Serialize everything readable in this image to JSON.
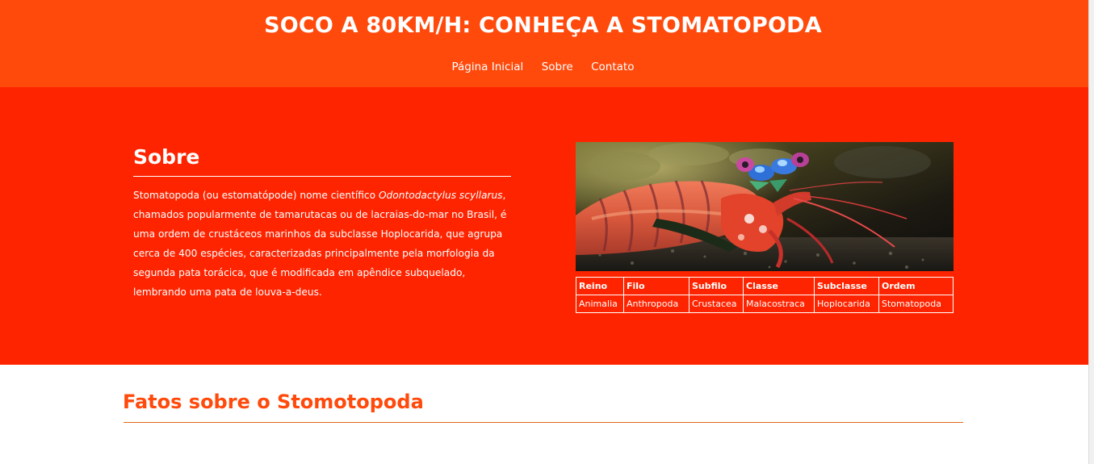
{
  "header": {
    "title": "SOCO A 80KM/H: CONHEÇA A STOMATOPODA",
    "nav": [
      {
        "label": "Página Inicial"
      },
      {
        "label": "Sobre"
      },
      {
        "label": "Contato"
      }
    ]
  },
  "about": {
    "heading": "Sobre",
    "text_before": "Stomatopoda (ou estomatópode) nome científico ",
    "scientific_name": "Odontodactylus scyllarus",
    "text_after": ", chamados popularmente de tamarutacas ou de lacraias-do-mar no Brasil, é uma ordem de crustáceos marinhos da subclasse Hoplocarida, que agrupa cerca de 400 espécies, caracterizadas principalmente pela morfologia da segunda pata torácica, que é modificada em apêndice subquelado, lembrando uma pata de louva-a-deus.",
    "image_subject": "mantis-shrimp-photo",
    "table": {
      "headers": [
        "Reino",
        "Filo",
        "Subfilo",
        "Classe",
        "Subclasse",
        "Ordem"
      ],
      "row": [
        "Animalia",
        "Anthropoda",
        "Crustacea",
        "Malacostraca",
        "Hoplocarida",
        "Stomatopoda"
      ]
    }
  },
  "facts": {
    "heading": "Fatos sobre o Stomotopoda"
  },
  "colors": {
    "header_bg": "#ff4a0c",
    "about_bg": "#ff2400",
    "facts_heading": "#ff4a0c",
    "facts_rule": "#e0681a"
  }
}
